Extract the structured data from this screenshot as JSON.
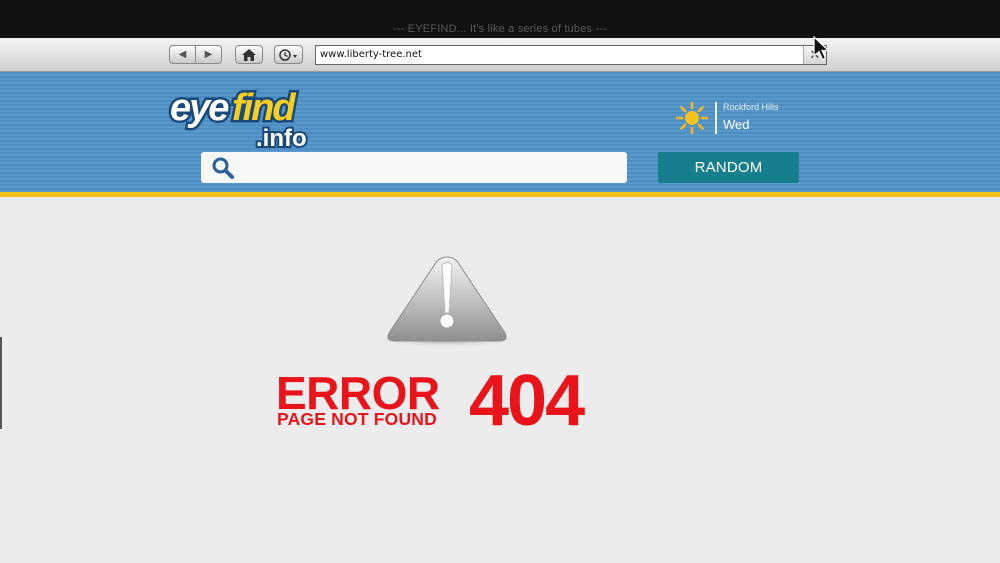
{
  "window": {
    "title": "--- EYEFIND... It's like a series of tubes ---"
  },
  "toolbar": {
    "back_icon": "back-arrow-icon",
    "forward_icon": "forward-arrow-icon",
    "home_icon": "home-icon",
    "history_icon": "clock-history-icon",
    "url": "www.liberty-tree.net",
    "clear_icon": "close-icon"
  },
  "site": {
    "logo_text_top": "eyefind",
    "logo_text_bottom": ".info",
    "weather": {
      "icon": "sun-icon",
      "location": "Rockford Hills",
      "day": "Wed"
    },
    "search": {
      "icon": "search-icon",
      "value": ""
    },
    "random_label": "RANDOM"
  },
  "error": {
    "icon": "warning-triangle-icon",
    "word": "ERROR",
    "subtitle": "PAGE NOT FOUND",
    "code": "404"
  },
  "colors": {
    "header_blue": "#4f92c8",
    "header_border": "#f2c01a",
    "random_button": "#167f8e",
    "error_red": "#e8141a"
  }
}
